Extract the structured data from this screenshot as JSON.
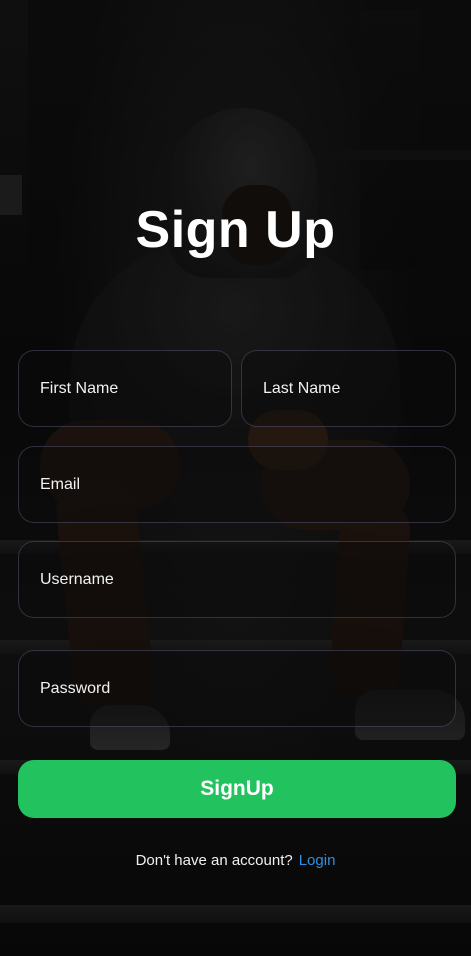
{
  "screen": {
    "title": "Sign Up"
  },
  "form": {
    "first_name": {
      "placeholder": "First Name",
      "value": ""
    },
    "last_name": {
      "placeholder": "Last Name",
      "value": ""
    },
    "email": {
      "placeholder": "Email",
      "value": ""
    },
    "username": {
      "placeholder": "Username",
      "value": ""
    },
    "password": {
      "placeholder": "Password",
      "value": ""
    }
  },
  "actions": {
    "signup_label": "SignUp"
  },
  "footer": {
    "prompt_text": "Don't have an account?",
    "login_label": "Login"
  },
  "colors": {
    "accent": "#22c35e",
    "link": "#2f8fe0",
    "text": "#ffffff"
  },
  "background": {
    "description_icon": "gym-hooded-athlete-background"
  }
}
